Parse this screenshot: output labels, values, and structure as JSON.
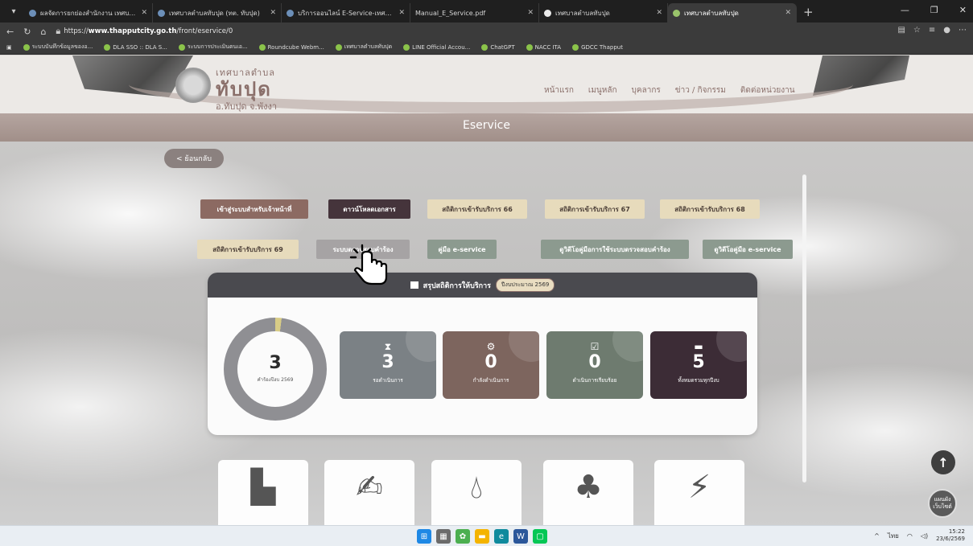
{
  "browser": {
    "tabs": [
      {
        "title": "ผลจัดการยกย่องสำนักงาน เทศบาล ตำบล",
        "active": false
      },
      {
        "title": "เทศบาลตำบลทับปุด (ทต. ทับปุด)",
        "active": false
      },
      {
        "title": "บริการออนไลน์ E-Service-เทศบาลตำบล",
        "active": false
      },
      {
        "title": "Manual_E_Service.pdf",
        "active": false
      },
      {
        "title": "เทศบาลตำบลทับปุด",
        "active": false
      },
      {
        "title": "เทศบาลตำบลทับปุด",
        "active": true
      }
    ],
    "url_prefix": "https://",
    "url_domain": "www.thapputcity.go.th",
    "url_path": "/front/eservice/0",
    "bookmarks": [
      "ระบบบันทึกข้อมูลของอ...",
      "DLA SSO :: DLA S...",
      "ระบบการประเมินตนเอ...",
      "Roundcube Webm...",
      "เทศบาลตำบลทับปุด",
      "LINE Official Accou...",
      "ChatGPT",
      "NACC ITA",
      "GDCC Thapput"
    ]
  },
  "site": {
    "brand_line1": "เทศบาลตำบล",
    "brand_line2": "ทับปุด",
    "brand_line3": "อ.ทับปุด จ.พังงา",
    "nav": [
      "หน้าแรก",
      "เมนูหลัก",
      "บุคลากร",
      "ข่าว / กิจกรรม",
      "ติดต่อหน่วยงาน"
    ],
    "page_title": "Eservice",
    "back_label": "< ย้อนกลับ"
  },
  "buttons": {
    "staff_login": "เข้าสู่ระบบสำหรับเจ้าหน้าที่",
    "download_docs": "ดาวน์โหลดเอกสาร",
    "stats66": "สถิติการเข้ารับบริการ 66",
    "stats67": "สถิติการเข้ารับบริการ 67",
    "stats68": "สถิติการเข้ารับบริการ 68",
    "stats69": "สถิติการเข้ารับบริการ 69",
    "check_system": "ระบบตรวจสอบคำร้อง",
    "manual": "คู่มือ e-service",
    "video_check": "ดูวิดีโอคู่มือการใช้ระบบตรวจสอบคำร้อง",
    "video_manual": "ดูวิดีโอคู่มือ e-service"
  },
  "summary": {
    "title": "สรุปสถิติการให้บริการ",
    "badge": "ปีงบประมาณ 2569",
    "total_requests": "3",
    "total_requests_label": "คำร้องปีงบ 2569",
    "stats": [
      {
        "value": "3",
        "label": "รอดำเนินการ",
        "icon": "hourglass-icon"
      },
      {
        "value": "0",
        "label": "กำลังดำเนินการ",
        "icon": "gear-icon"
      },
      {
        "value": "0",
        "label": "ดำเนินการเรียบร้อย",
        "icon": "check-icon"
      },
      {
        "value": "5",
        "label": "ทั้งหมดรวมทุกปีงบ",
        "icon": "folder-icon"
      }
    ]
  },
  "floating": {
    "map_label_1": "แผนผัง",
    "map_label_2": "เว็บไซต์"
  },
  "taskbar": {
    "lang": "ไทย",
    "time": "15:22",
    "date": "23/6/2569"
  }
}
